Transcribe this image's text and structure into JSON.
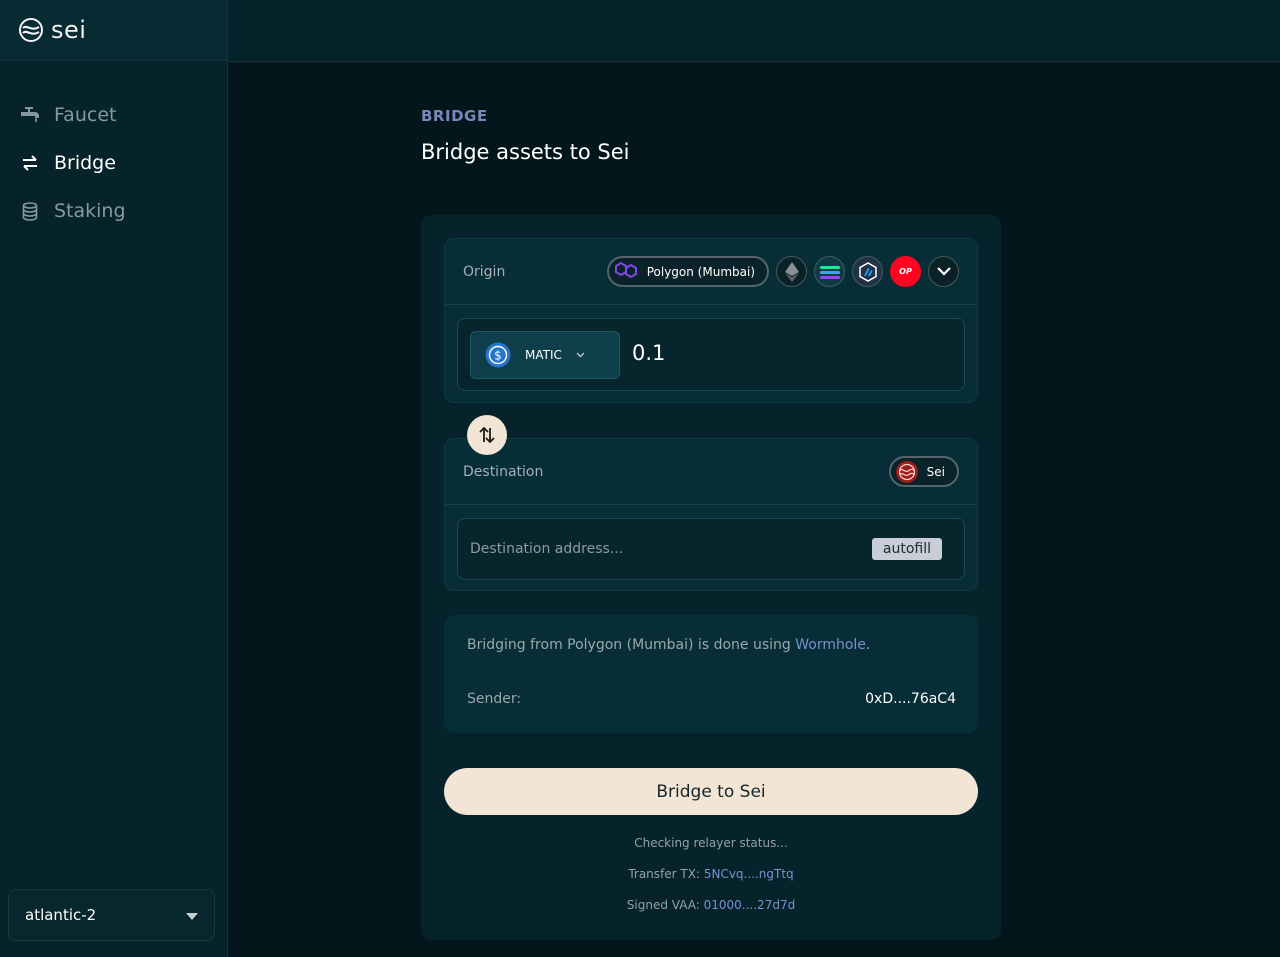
{
  "brand": {
    "name": "sei"
  },
  "sidebar": {
    "items": [
      {
        "label": "Faucet",
        "icon": "faucet-icon",
        "active": false
      },
      {
        "label": "Bridge",
        "icon": "arrows-exchange-icon",
        "active": true
      },
      {
        "label": "Staking",
        "icon": "database-stack-icon",
        "active": false
      }
    ],
    "network": "atlantic-2"
  },
  "page": {
    "kicker": "BRIDGE",
    "title": "Bridge assets to Sei"
  },
  "origin": {
    "label": "Origin",
    "selected_chain": "Polygon (Mumbai)",
    "other_chains": [
      "ethereum",
      "solana",
      "arbitrum",
      "optimism"
    ],
    "op_badge": "OP",
    "token": "MATIC",
    "amount": "0.1"
  },
  "destination": {
    "label": "Destination",
    "chain": "Sei",
    "address_placeholder": "Destination address...",
    "autofill": "autofill"
  },
  "info": {
    "prefix": "Bridging from Polygon (Mumbai) is done using ",
    "link": "Wormhole",
    "suffix": ".",
    "sender_label": "Sender:",
    "sender_value": "0xD....76aC4"
  },
  "action": {
    "label": "Bridge to Sei"
  },
  "status": {
    "relayer": "Checking relayer status...",
    "transfer_label": "Transfer TX:",
    "transfer_value": "5NCvq....ngTtq",
    "vaa_label": "Signed VAA:",
    "vaa_value": "01000....27d7d"
  },
  "colors": {
    "accent": "#7b86bd",
    "button": "#f2e5d6",
    "background": "#03161b"
  }
}
